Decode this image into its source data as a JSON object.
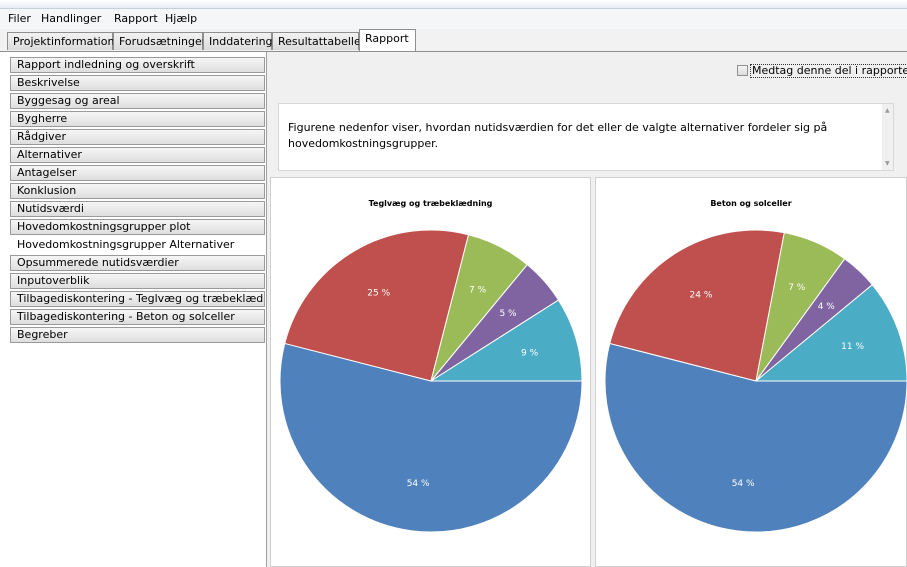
{
  "menu": [
    "Filer",
    "Handlinger",
    "Rapport",
    "Hjælp"
  ],
  "tabs": [
    "Projektinformation",
    "Forudsætninger",
    "Inddatering",
    "Resultattabeller",
    "Rapport"
  ],
  "active_tab": "Rapport",
  "sidebar": {
    "items": [
      "Rapport indledning og overskrift",
      "Beskrivelse",
      "Byggesag og areal",
      "Bygherre",
      "Rådgiver",
      "Alternativer",
      "Antagelser",
      "Konklusion",
      "Nutidsværdi",
      "Hovedomkostningsgrupper plot",
      "Hovedomkostningsgrupper Alternativer",
      "Opsummerede nutidsværdier",
      "Inputoverblik",
      "Tilbagediskontering - Teglvæg og træbeklædning",
      "Tilbagediskontering - Beton og solceller",
      "Begreber"
    ],
    "active_item": "Hovedomkostningsgrupper Alternativer"
  },
  "include_checkbox": {
    "label": "Medtag denne del i rapporten",
    "checked": false
  },
  "description": "Figurene nedenfor viser, hvordan nutidsværdien for det eller de valgte alternativer fordeler sig på hovedomkostningsgrupper.",
  "chart_data": [
    {
      "type": "pie",
      "title": "Teglvæg og træbeklædning",
      "values": [
        54,
        25,
        7,
        5,
        9
      ],
      "labels": [
        "54 %",
        "25 %",
        "7 %",
        "5 %",
        "9 %"
      ],
      "colors": [
        "#4f81bd",
        "#c0504d",
        "#9bbb59",
        "#8064a2",
        "#4bacc6"
      ]
    },
    {
      "type": "pie",
      "title": "Beton og solceller",
      "values": [
        54,
        24,
        7,
        4,
        11
      ],
      "labels": [
        "54 %",
        "24 %",
        "7 %",
        "4 %",
        "11 %"
      ],
      "colors": [
        "#4f81bd",
        "#c0504d",
        "#9bbb59",
        "#8064a2",
        "#4bacc6"
      ]
    }
  ]
}
